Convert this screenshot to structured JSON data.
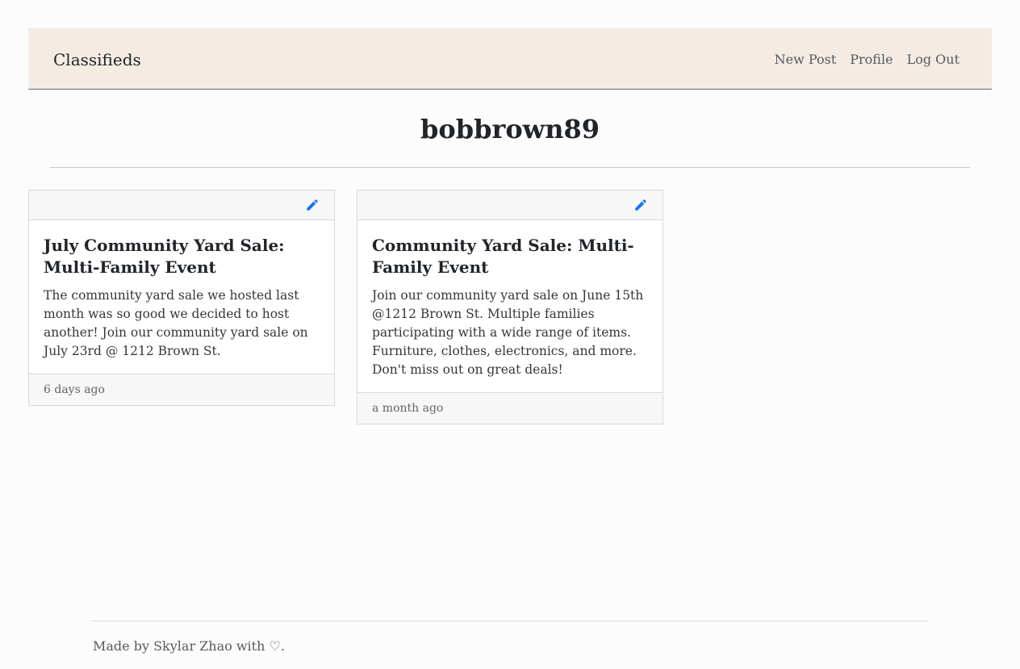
{
  "navbar": {
    "brand": "Classifieds",
    "links": [
      {
        "label": "New Post"
      },
      {
        "label": "Profile"
      },
      {
        "label": "Log Out"
      }
    ],
    "background": "#f4ebe3"
  },
  "profile": {
    "username": "bobbrown89"
  },
  "posts": [
    {
      "title": "July Community Yard Sale: Multi-Family Event",
      "description": "The community yard sale we hosted last month was so good we decided to host another! Join our community yard sale on July 23rd @ 1212 Brown St.",
      "time": "6 days ago",
      "edit_icon": "pencil-icon"
    },
    {
      "title": "Community Yard Sale: Multi-Family Event",
      "description": "Join our community yard sale on June 15th @1212 Brown St. Multiple families participating with a wide range of items. Furniture, clothes, electronics, and more. Don't miss out on great deals!",
      "time": "a month ago",
      "edit_icon": "pencil-icon"
    }
  ],
  "footer": {
    "text": "Made by Skylar Zhao with ♡."
  },
  "colors": {
    "accent": "#1a73e8"
  }
}
